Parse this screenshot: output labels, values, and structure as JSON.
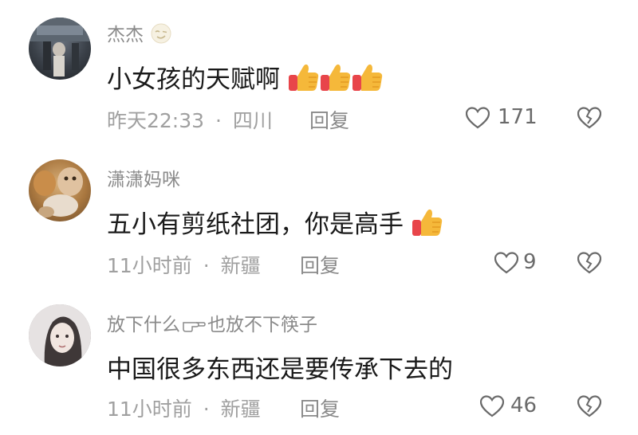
{
  "comments": [
    {
      "username": "杰杰",
      "username_emoji": "wink-face-icon",
      "text": "小女孩的天赋啊",
      "text_emoji": [
        "thumbs-up-icon",
        "thumbs-up-icon",
        "thumbs-up-icon"
      ],
      "time": "昨天22:33",
      "location": "四川",
      "separator": "·",
      "reply_label": "回复",
      "likes": "171"
    },
    {
      "username": "潇潇妈咪",
      "text": "五小有剪纸社团，你是高手",
      "text_emoji": [
        "thumbs-up-icon"
      ],
      "time": "11小时前",
      "location": "新疆",
      "separator": "·",
      "reply_label": "回复",
      "likes": "9"
    },
    {
      "username_part1": "放下什么",
      "username_emoji": "pointing-hand-icon",
      "username_part2": "也放不下筷子",
      "text": "中国很多东西还是要传承下去的",
      "time": "11小时前",
      "location": "新疆",
      "separator": "·",
      "reply_label": "回复",
      "likes": "46"
    }
  ],
  "colors": {
    "username": "#8a8a8a",
    "text": "#1a1a1a",
    "meta": "#a0a0a0",
    "icon": "#6a6a6a",
    "thumb_yellow": "#f5b83a",
    "thumb_red": "#e8454a"
  }
}
